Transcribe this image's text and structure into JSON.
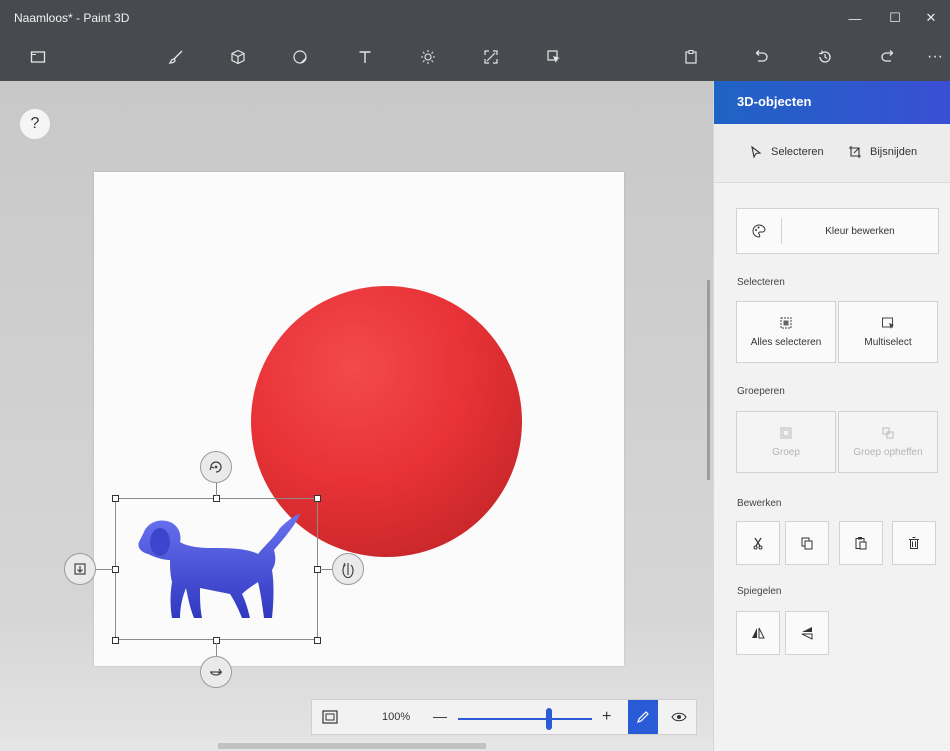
{
  "window": {
    "title": "Naamloos* - Paint 3D",
    "controls": {
      "minimize": "—",
      "maximize": "☐",
      "close": "✕"
    }
  },
  "toolbar": {
    "more": "···",
    "tools": [
      "menu-icon",
      "brush-icon",
      "cube-icon",
      "sticker-icon",
      "text-icon",
      "effects-icon",
      "canvas-icon",
      "3d-library-icon",
      "paste-icon",
      "undo-icon",
      "history-icon",
      "redo-icon"
    ]
  },
  "canvas": {
    "help": "?",
    "zoom": {
      "value": "100%",
      "minus": "—",
      "plus": "+",
      "level_percent": 68
    }
  },
  "panel": {
    "title": "3D-objecten",
    "modes": {
      "select": "Selecteren",
      "crop": "Bijsnijden"
    },
    "edit_color": "Kleur bewerken",
    "sections": {
      "select": "Selecteren",
      "group": "Groeperen",
      "edit": "Bewerken",
      "mirror": "Spiegelen"
    },
    "select_all": "Alles selecteren",
    "multiselect": "Multiselect",
    "group": "Groep",
    "ungroup": "Groep opheffen"
  },
  "colors": {
    "titlebar": "#474b50",
    "accent": "#2a5bd7",
    "sphere": "#e83236",
    "dog": "#4e57e0"
  }
}
